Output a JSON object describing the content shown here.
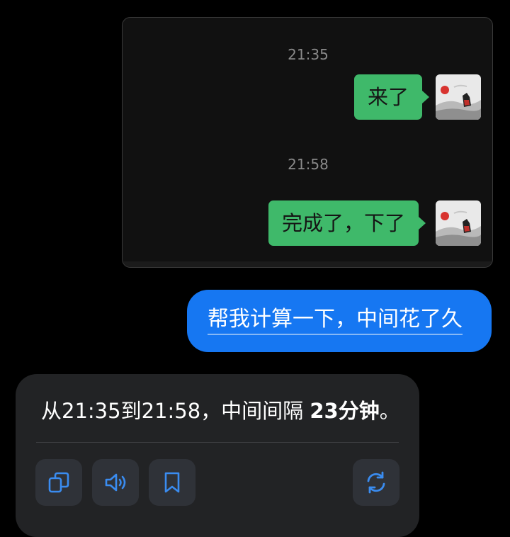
{
  "chat_screenshot": {
    "messages": [
      {
        "time": "21:35",
        "text": "来了"
      },
      {
        "time": "21:58",
        "text": "完成了，下了"
      }
    ]
  },
  "query": {
    "text": "帮我计算一下，中间花了久"
  },
  "answer": {
    "prefix": "从21:35到21:58，中间间隔 ",
    "highlight": "23分钟",
    "suffix": "。"
  },
  "actions": [
    {
      "name": "copy-icon"
    },
    {
      "name": "speaker-icon"
    },
    {
      "name": "bookmark-icon"
    },
    {
      "name": "regenerate-icon"
    }
  ],
  "colors": {
    "message_green": "#3fb96a",
    "query_blue": "#1677f2",
    "icon_blue": "#3a8cf0",
    "card_bg": "#222325"
  }
}
